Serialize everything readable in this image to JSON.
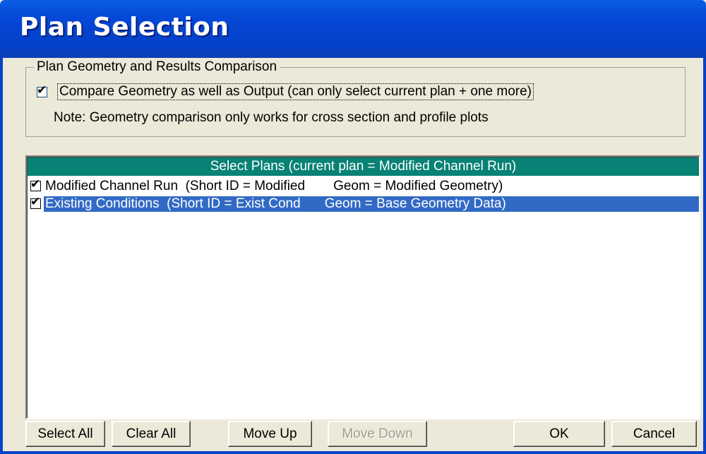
{
  "window": {
    "title": "Plan Selection"
  },
  "comparison_group": {
    "legend": "Plan Geometry and Results Comparison",
    "compare_checkbox": {
      "checked": true,
      "label": "Compare Geometry as well as Output (can only select current plan + one more)"
    },
    "note": "Note: Geometry comparison only works for cross section and profile plots"
  },
  "plans_list": {
    "header": "Select Plans  (current plan = Modified Channel Run)",
    "rows": [
      {
        "checked": true,
        "selected": false,
        "name": "Modified Channel Run  (Short ID = Modified",
        "geom": "Geom = Modified Geometry)"
      },
      {
        "checked": true,
        "selected": true,
        "name": "Existing Conditions  (Short ID = Exist Cond",
        "geom": "Geom = Base Geometry Data)"
      }
    ]
  },
  "buttons": {
    "select_all": "Select All",
    "clear_all": "Clear All",
    "move_up": "Move Up",
    "move_down": "Move Down",
    "ok": "OK",
    "cancel": "Cancel"
  },
  "colors": {
    "title_bar": "#0549d6",
    "list_header": "#078275",
    "selection": "#316ac5",
    "dialog_bg": "#ece9d8"
  }
}
